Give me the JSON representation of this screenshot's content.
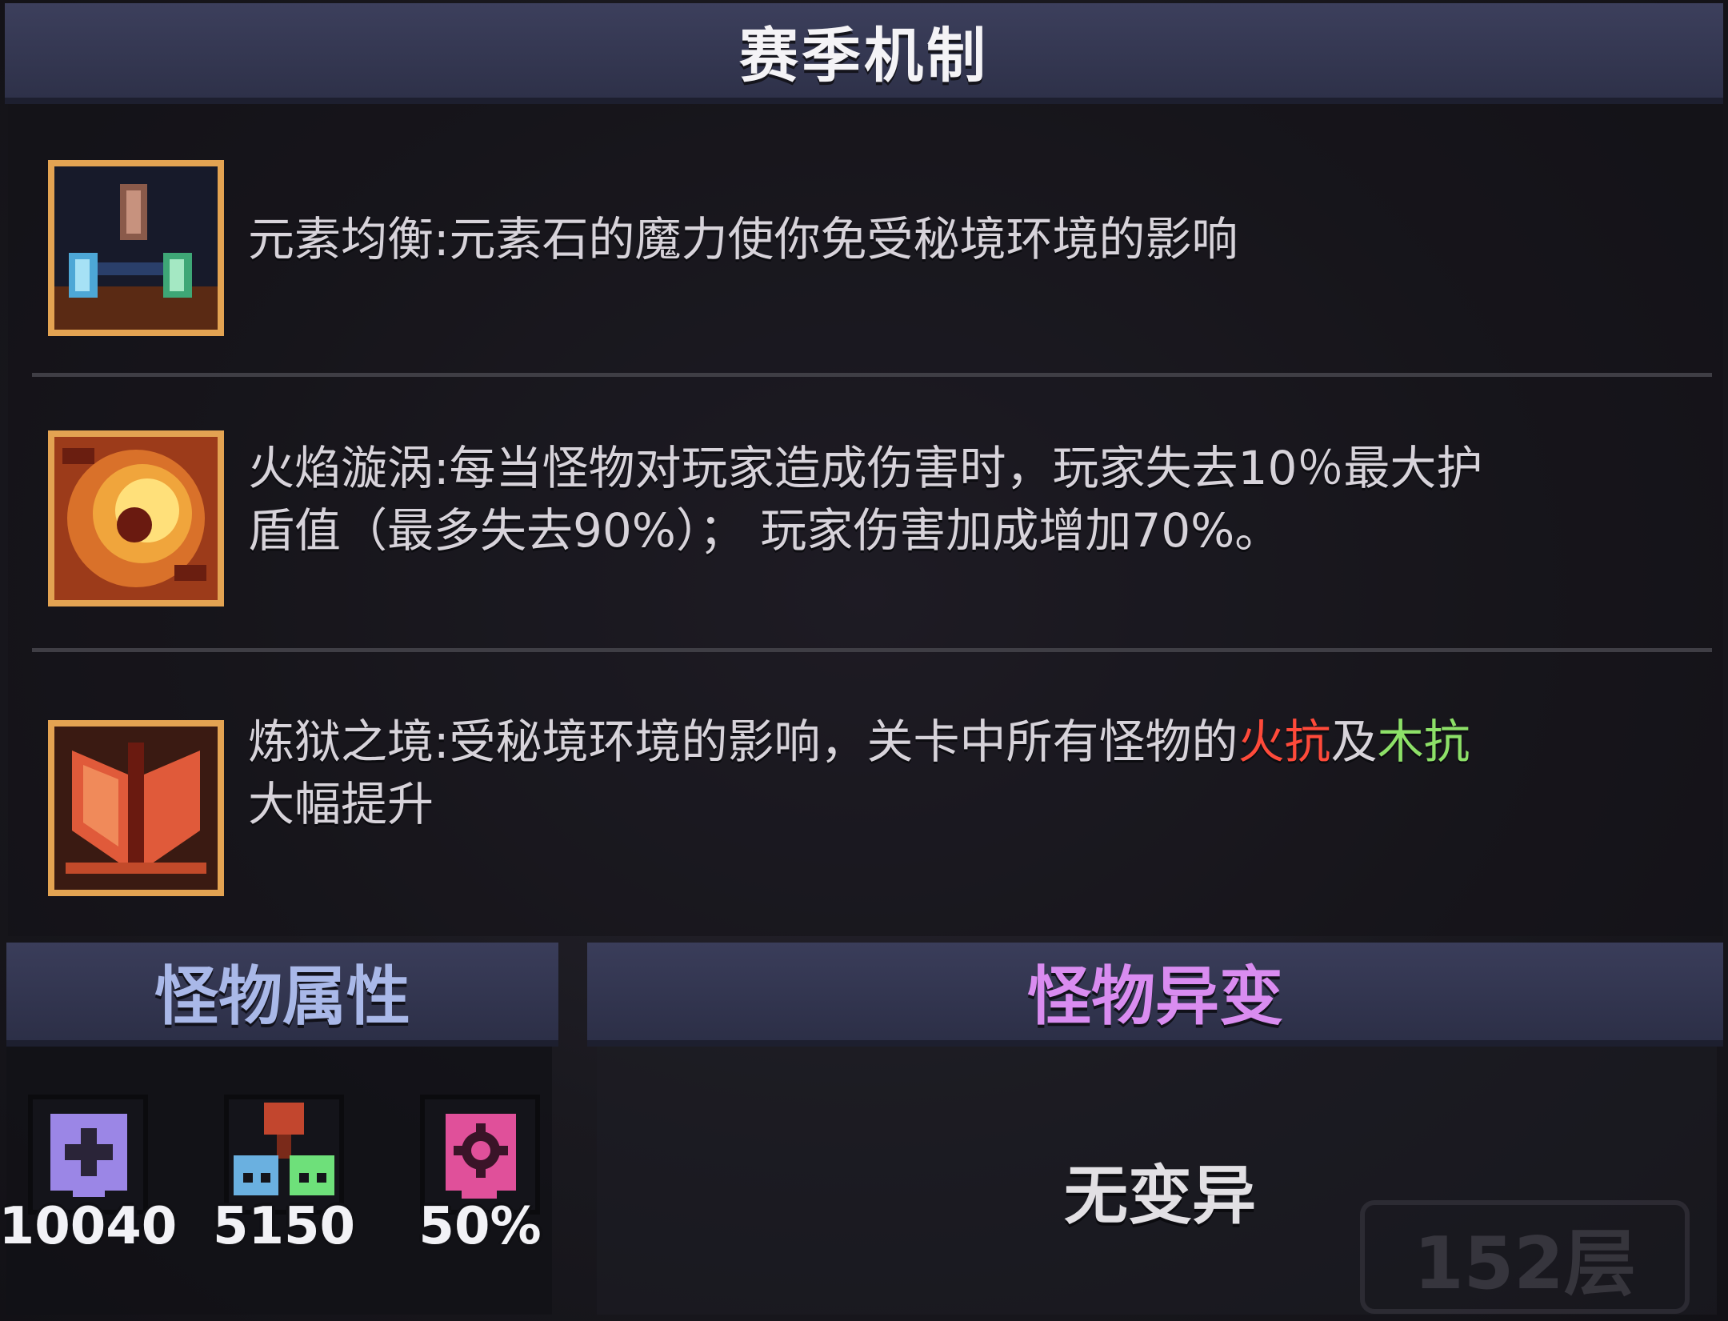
{
  "header": {
    "title": "赛季机制"
  },
  "mechanics": [
    {
      "icon": "elemental-stones-icon",
      "text": "元素均衡:元素石的魔力使你免受秘境环境的影响"
    },
    {
      "icon": "flame-vortex-icon",
      "line1": "火焰漩涡:每当怪物对玩家造成伤害时，玩家失去10％最大护",
      "line2": "盾值（最多失去90%）； 玩家伤害加成增加70%。"
    },
    {
      "icon": "purgatory-shield-icon",
      "prefix": "炼狱之境:受秘境环境的影响，关卡中所有怪物的",
      "fire": "火抗",
      "mid": "及",
      "wood": "木抗",
      "line2": "大幅提升"
    }
  ],
  "monster_stats": {
    "title": "怪物属性",
    "items": [
      {
        "icon": "health-plus-icon",
        "value": "10040"
      },
      {
        "icon": "attack-skulls-icon",
        "value": "5150"
      },
      {
        "icon": "gear-crit-icon",
        "value": "50%"
      }
    ]
  },
  "monster_mutation": {
    "title": "怪物异变",
    "status": "无变异"
  },
  "floor_badge": "152层",
  "colors": {
    "fire_resist": "#ff4a3a",
    "wood_resist": "#8de068",
    "stats_title": "#a9b8e8",
    "mutation_title": "#d98cf0"
  }
}
